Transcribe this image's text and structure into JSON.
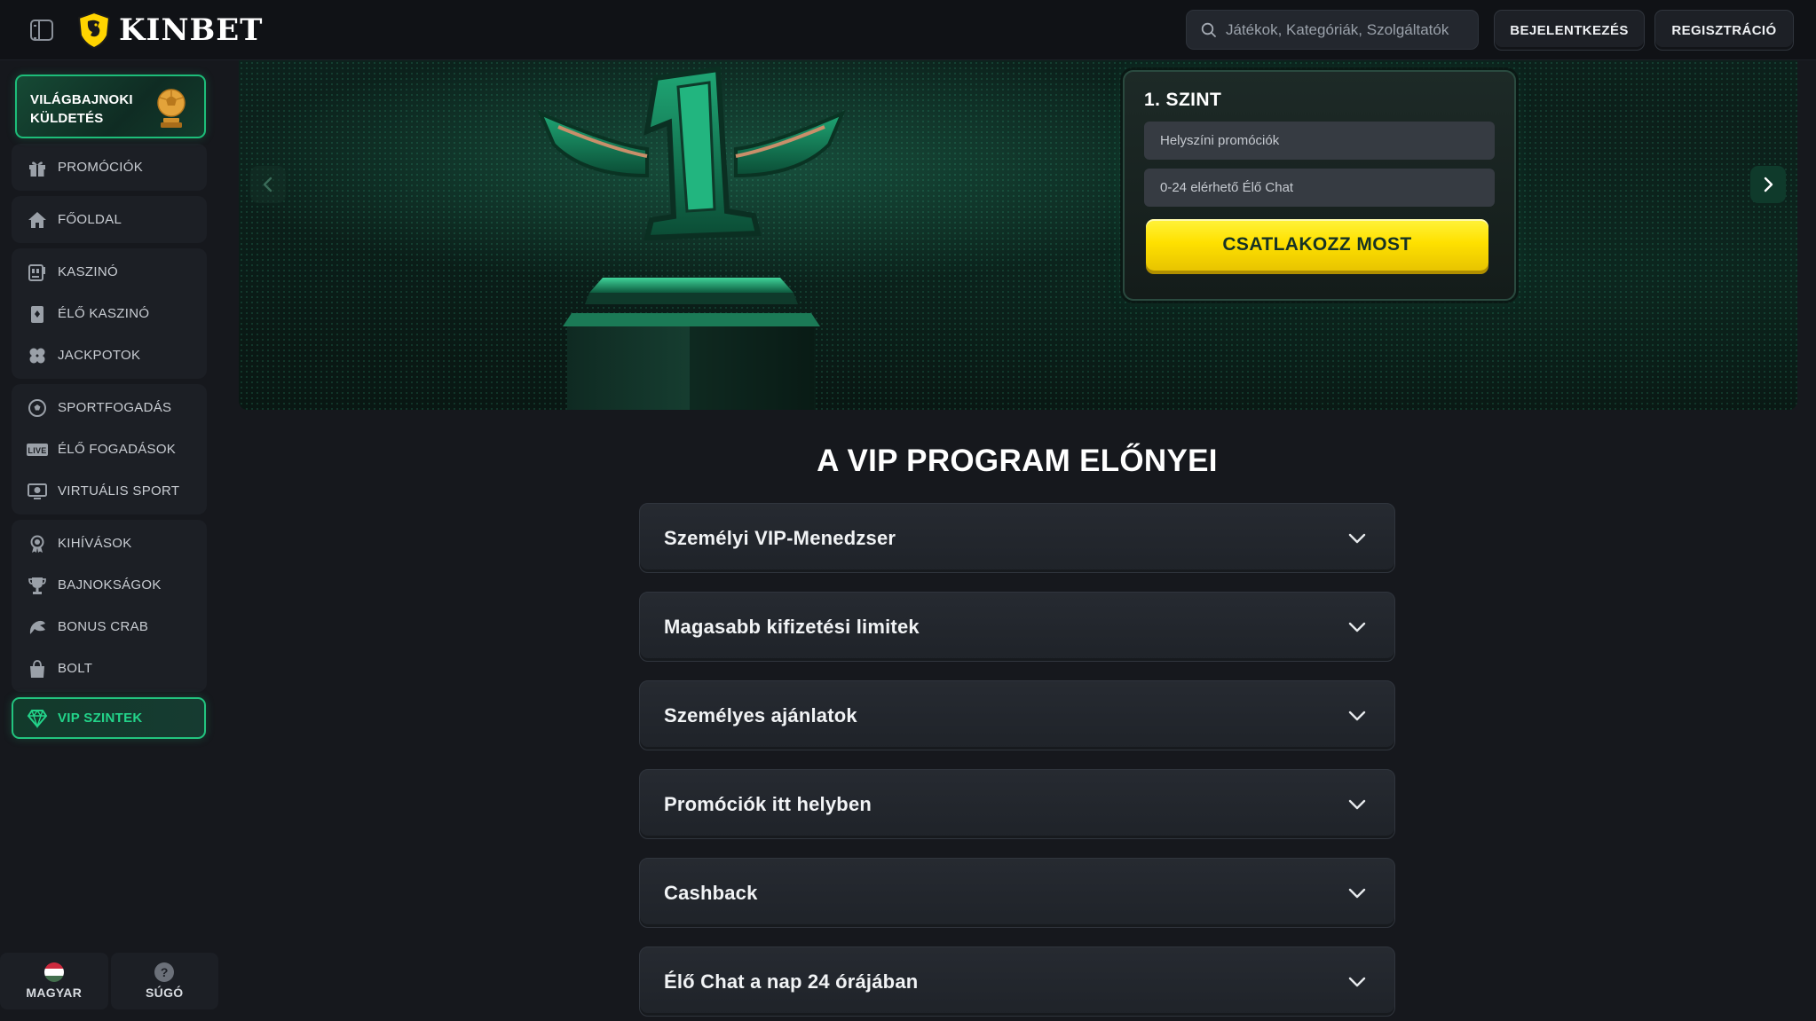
{
  "header": {
    "brand": "KINBET",
    "search_placeholder": "Játékok, Kategóriák, Szolgáltatók",
    "login_label": "BEJELENTKEZÉS",
    "register_label": "REGISZTRÁCIÓ"
  },
  "sidebar": {
    "quest_label": "VILÁGBAJNOKI KÜLDETÉS",
    "groups": [
      [
        {
          "label": "PROMÓCIÓK",
          "icon": "gift-icon"
        }
      ],
      [
        {
          "label": "FŐOLDAL",
          "icon": "home-icon"
        }
      ],
      [
        {
          "label": "KASZINÓ",
          "icon": "slot-machine-icon"
        },
        {
          "label": "ÉLŐ KASZINÓ",
          "icon": "playing-card-icon"
        },
        {
          "label": "JACKPOTOK",
          "icon": "clover-icon"
        }
      ],
      [
        {
          "label": "SPORTFOGADÁS",
          "icon": "soccer-ball-icon"
        },
        {
          "label": "ÉLŐ FOGADÁSOK",
          "icon": "live-badge-icon"
        },
        {
          "label": "VIRTUÁLIS SPORT",
          "icon": "monitor-ball-icon"
        }
      ],
      [
        {
          "label": "KIHÍVÁSOK",
          "icon": "medal-icon"
        },
        {
          "label": "BAJNOKSÁGOK",
          "icon": "trophy-icon"
        },
        {
          "label": "BONUS CRAB",
          "icon": "crab-claw-icon"
        },
        {
          "label": "BOLT",
          "icon": "shopping-bag-icon"
        }
      ]
    ],
    "vip_label": "VIP SZINTEK",
    "bottom": {
      "language_label": "MAGYAR",
      "help_label": "SÚGÓ"
    }
  },
  "banner": {
    "level_title": "1. SZINT",
    "perks": [
      "Helyszíni promóciók",
      "0-24 elérhető Élő Chat"
    ],
    "cta_label": "CSATLAKOZZ MOST"
  },
  "main": {
    "section_title": "A VIP PROGRAM ELŐNYEI",
    "benefits": [
      "Személyi VIP-Menedzser",
      "Magasabb kifizetési limitek",
      "Személyes ajánlatok",
      "Promóciók itt helyben",
      "Cashback",
      "Élő Chat a nap 24 órájában"
    ]
  },
  "colors": {
    "accent_green": "#22c47f",
    "cta_yellow": "#ffe100",
    "background": "#16181d"
  }
}
